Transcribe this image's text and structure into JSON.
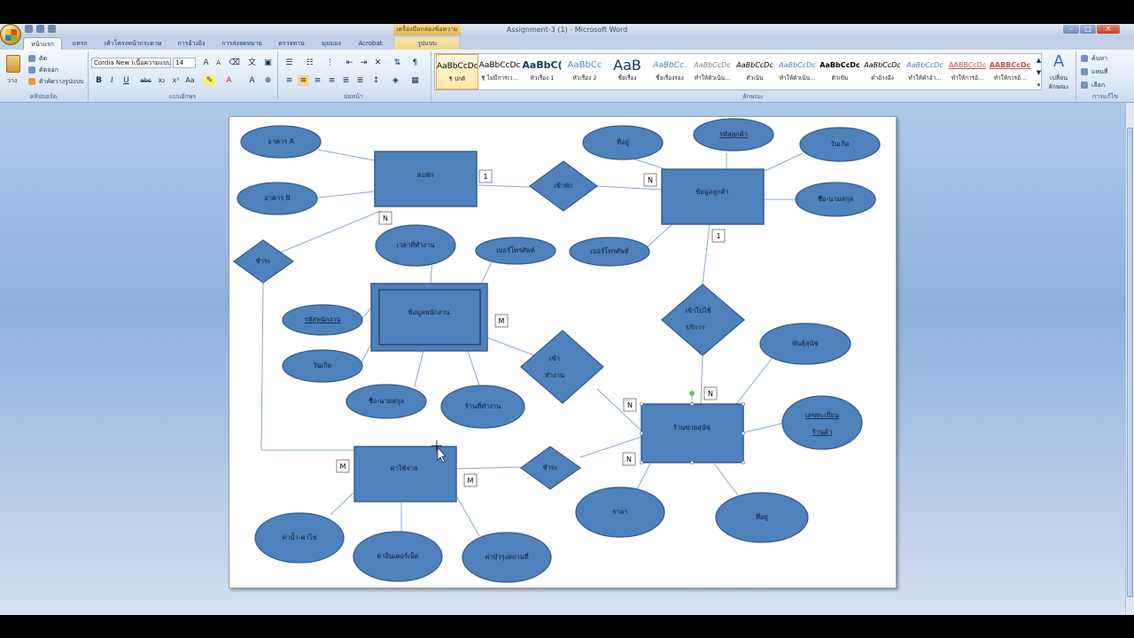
{
  "window": {
    "title": "Assignment-3 (1) - Microsoft Word",
    "contextual_tab_title": "เครื่องมือกล่องข้อความ"
  },
  "tabs": [
    {
      "label": "หน้าแรก"
    },
    {
      "label": "แทรก"
    },
    {
      "label": "เค้าโครงหน้ากระดาษ"
    },
    {
      "label": "การอ้างอิง"
    },
    {
      "label": "การส่งจดหมาย"
    },
    {
      "label": "ตรวจทาน"
    },
    {
      "label": "มุมมอง"
    },
    {
      "label": "Acrobat"
    },
    {
      "label": "รูปแบบ"
    }
  ],
  "ribbon": {
    "clipboard": {
      "paste_label": "วาง",
      "cut": "ตัด",
      "copy": "คัดลอก",
      "format_painter": "ตัวคัดวางรูปแบบ",
      "group": "คลิปบอร์ด"
    },
    "font": {
      "font_name": "Cordia New (เนื้อความแบบ",
      "font_size": "14",
      "group": "แบบอักษร"
    },
    "paragraph": {
      "group": "ย่อหน้า"
    },
    "styles": {
      "group": "ลักษณะ",
      "change_styles": "เปลี่ยน",
      "change_styles_2": "ลักษณะ",
      "items": [
        {
          "preview": "AaBbCcDc",
          "name": "¶ ปกติ"
        },
        {
          "preview": "AaBbCcDc",
          "name": "¶ ไม่มีการเว..."
        },
        {
          "preview": "AaBbC(",
          "name": "หัวเรื่อง 1"
        },
        {
          "preview": "AaBbCc",
          "name": "หัวเรื่อง 2"
        },
        {
          "preview": "AaB",
          "name": "ชื่อเรื่อง"
        },
        {
          "preview": "AaBbCc.",
          "name": "ชื่อเรื่องรอง"
        },
        {
          "preview": "AaBbCcDc",
          "name": "ทำให้ตัวเน้น..."
        },
        {
          "preview": "AaBbCcDc",
          "name": "ตัวเน้น"
        },
        {
          "preview": "AaBbCcDc",
          "name": "ทำให้ตัวเน้น..."
        },
        {
          "preview": "AaBbCcDc",
          "name": "ตัวเข้ม"
        },
        {
          "preview": "AaBbCcDc",
          "name": "คำอ้างอิง"
        },
        {
          "preview": "AaBbCcDc",
          "name": "ทำให้คำอ้า..."
        },
        {
          "preview": "AABBCcDc",
          "name": "ทำให้การอ้..."
        },
        {
          "preview": "AABBCcDc",
          "name": "ทำให้การอ้..."
        }
      ]
    },
    "editing": {
      "find": "ค้นหา",
      "replace": "แทนที่",
      "select": "เลือก",
      "group": "การแก้ไข"
    }
  },
  "diagram": {
    "entities": {
      "dorm": "หอพัก",
      "customer": "ข้อมูลลูกค้า",
      "employee": "ข้อมูลพนักงาน",
      "expense": "ค่าใช้จ่าย",
      "shop": "ร้านขายสุนัข"
    },
    "relationships": {
      "stay": "เข้าพัก",
      "pay_left": "ชำระ",
      "work_1": "เข้า",
      "work_2": "ทำงาน",
      "use_1": "เข้าไปใช้",
      "use_2": "บริการ",
      "pay_bottom": "ชำระ"
    },
    "attributes": {
      "building_a": "อาคาร A",
      "building_b": "อาคาร B",
      "address_cust": "ที่อยู่",
      "customer_id": "รหัสลูกค้า",
      "birthday_cust": "วันเกิด",
      "name_cust": "ชื่อ-นามสกุล",
      "phone_cust": "เบอร์โทรศัพท์",
      "work_time": "เวลาที่ทำงาน",
      "phone_emp": "เบอร์โทรศัพท์",
      "employee_id": "รหัสพนักงาน",
      "birthday_emp": "วันเกิด",
      "name_emp": "ชื่อ-นามสกุล",
      "work_shop": "ร้านที่ทำงาน",
      "breed": "พันธุ์สุนัข",
      "reg_no_1": "เลขทะเบียน",
      "reg_no_2": "ร้านค้า",
      "price": "ราคา",
      "address_shop": "ที่อยู่",
      "utilities": "ค่าน้ำ-ค่าไฟ",
      "dog_food": "ค่าอินเตอร์เน็ต",
      "maintenance": "ค่าบำรุงสถานที่"
    },
    "cardinalities": {
      "c1": "1",
      "c2": "N",
      "c3": "N",
      "c4": "1",
      "c5": "M",
      "c6": "N",
      "c7": "N",
      "c8": "N",
      "c9": "M",
      "c10": "M"
    }
  }
}
